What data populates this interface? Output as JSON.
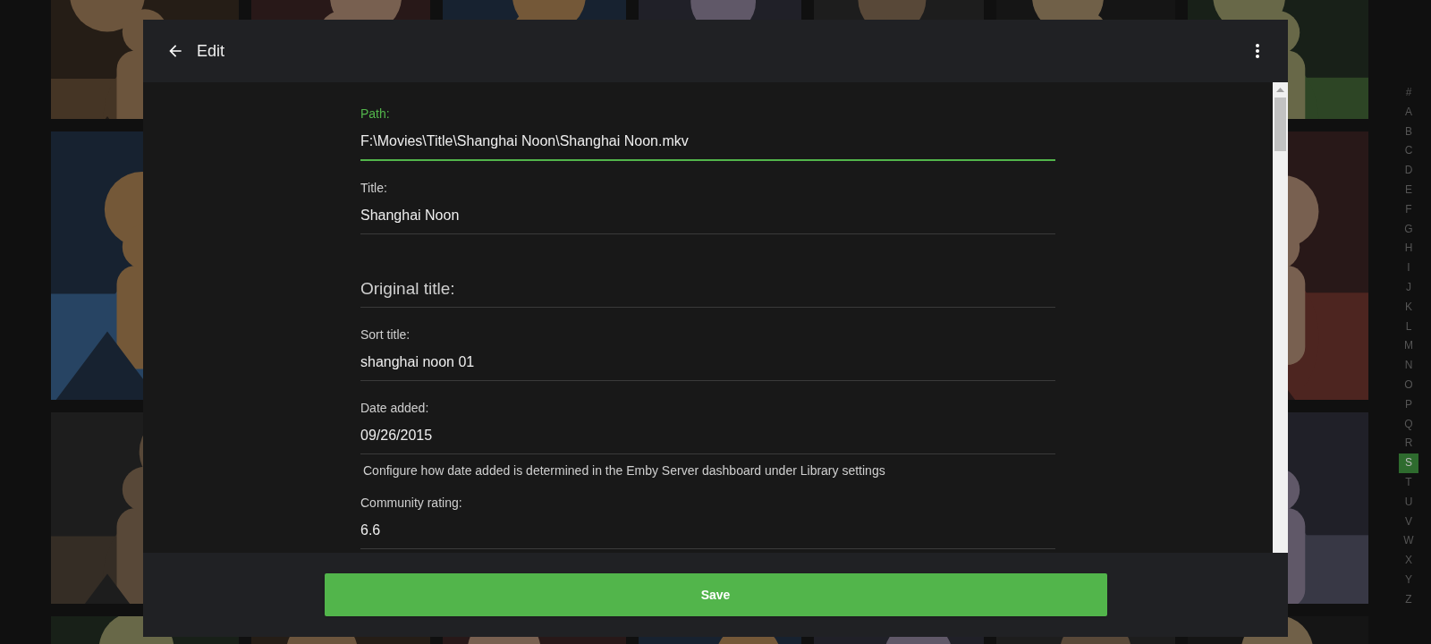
{
  "dialog": {
    "title": "Edit",
    "fields": [
      {
        "kind": "field",
        "label": "Path:",
        "value": "F:\\Movies\\Title\\Shanghai Noon\\Shanghai Noon.mkv",
        "focused": true
      },
      {
        "kind": "field",
        "label": "Title:",
        "value": "Shanghai Noon",
        "focused": false
      },
      {
        "kind": "field",
        "label": "Original title:",
        "focused": false
      },
      {
        "kind": "field",
        "label": "Sort title:",
        "value": "shanghai noon 01",
        "focused": false
      },
      {
        "kind": "field",
        "label": "Date added:",
        "value": "09/26/2015",
        "focused": false
      },
      {
        "kind": "note",
        "text": "Configure how date added is determined in the Emby Server dashboard under Library settings"
      },
      {
        "kind": "field",
        "label": "Community rating:",
        "value": "6.6",
        "focused": false
      }
    ],
    "save_button": "Save"
  },
  "alphabet": [
    {
      "letter": "#",
      "selected": false
    },
    {
      "letter": "A",
      "selected": false
    },
    {
      "letter": "B",
      "selected": false
    },
    {
      "letter": "C",
      "selected": false
    },
    {
      "letter": "D",
      "selected": false
    },
    {
      "letter": "E",
      "selected": false
    },
    {
      "letter": "F",
      "selected": false
    },
    {
      "letter": "G",
      "selected": false
    },
    {
      "letter": "H",
      "selected": false
    },
    {
      "letter": "I",
      "selected": false
    },
    {
      "letter": "J",
      "selected": false
    },
    {
      "letter": "K",
      "selected": false
    },
    {
      "letter": "L",
      "selected": false
    },
    {
      "letter": "M",
      "selected": false
    },
    {
      "letter": "N",
      "selected": false
    },
    {
      "letter": "O",
      "selected": false
    },
    {
      "letter": "P",
      "selected": false
    },
    {
      "letter": "Q",
      "selected": false
    },
    {
      "letter": "R",
      "selected": false
    },
    {
      "letter": "S",
      "selected": true
    },
    {
      "letter": "T",
      "selected": false
    },
    {
      "letter": "U",
      "selected": false
    },
    {
      "letter": "V",
      "selected": false
    },
    {
      "letter": "W",
      "selected": false
    },
    {
      "letter": "X",
      "selected": false
    },
    {
      "letter": "Y",
      "selected": false
    },
    {
      "letter": "Z",
      "selected": false
    }
  ]
}
